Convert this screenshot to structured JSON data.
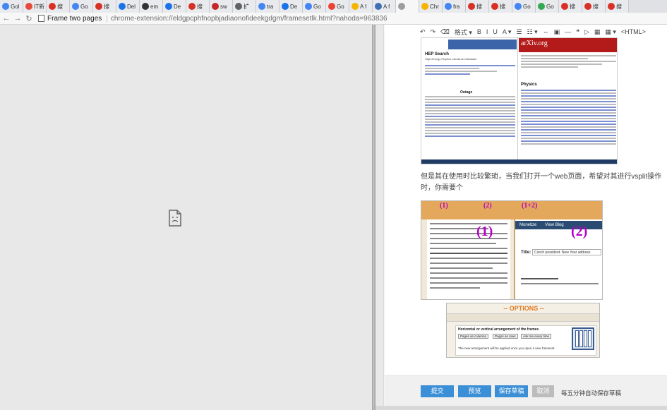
{
  "browser": {
    "tabs": [
      {
        "label": "Gol",
        "color": "#4285f4"
      },
      {
        "label": "IT新",
        "color": "#e64b3b"
      },
      {
        "label": "搜",
        "color": "#d93025"
      },
      {
        "label": "Go",
        "color": "#4285f4"
      },
      {
        "label": "搜",
        "color": "#d93025"
      },
      {
        "label": "Del",
        "color": "#1a73e8"
      },
      {
        "label": "em",
        "color": "#333333"
      },
      {
        "label": "De",
        "color": "#1a73e8"
      },
      {
        "label": "搜",
        "color": "#d93025"
      },
      {
        "label": "sw",
        "color": "#c62828"
      },
      {
        "label": "扩",
        "color": "#5f6368"
      },
      {
        "label": "tra",
        "color": "#4285f4"
      },
      {
        "label": "De",
        "color": "#1a73e8"
      },
      {
        "label": "Go",
        "color": "#4285f4"
      },
      {
        "label": "Go",
        "color": "#ea4335"
      },
      {
        "label": "A f",
        "color": "#f4b400"
      },
      {
        "label": "A f",
        "color": "#3f6fb5"
      },
      {
        "label": "",
        "color": "#9e9e9e",
        "active": true
      },
      {
        "label": "Chr",
        "color": "#f4b400"
      },
      {
        "label": "fra",
        "color": "#4285f4"
      },
      {
        "label": "搜",
        "color": "#d93025"
      },
      {
        "label": "搜",
        "color": "#d93025"
      },
      {
        "label": "Go",
        "color": "#4285f4"
      },
      {
        "label": "Go",
        "color": "#34a853"
      },
      {
        "label": "搜",
        "color": "#d93025"
      },
      {
        "label": "搜",
        "color": "#d93025"
      },
      {
        "label": "搜",
        "color": "#d93025"
      }
    ],
    "nav": {
      "back": "←",
      "forward": "→",
      "reload": "↻"
    },
    "page_title": "Frame two pages",
    "url_sep": "|",
    "url": "chrome-extension://eldgpcphfnopbjadiaonofideekgdgm/framesetlk.html?nahoda=963836"
  },
  "left_frame": {
    "placeholder_icon": "broken-page-icon"
  },
  "editor": {
    "toolbar": [
      "↶",
      "↷",
      "⌫",
      "格式 ▾",
      "B",
      "I",
      "U",
      "A ▾",
      "☰",
      "☷ ▾",
      "⇔",
      "▣",
      "—",
      "❝",
      "▷",
      "▦",
      "▦ ▾",
      "<HTML>"
    ],
    "shot1": {
      "hep_title": "HEP Search",
      "hep_subtitle": "High-Energy Physics Literature Database",
      "hep_outage": "Outage",
      "arxiv_logo": "arXiv.org",
      "arxiv_section": "Physics"
    },
    "paragraph": "但是其在使用时比较繁琐，当我们打开一个web页面，希望对其进行vsplit操作时，你需要个",
    "shot2": {
      "ann1": "(1)",
      "ann2": "(2)",
      "ann3": "(1+2)",
      "ann_big1": "(1)",
      "ann_big2": "(2)",
      "blogger_tab1": "Monetize",
      "blogger_tab2": "View Blog",
      "title_label": "Title:",
      "title_value": "Czech president: New Year address"
    },
    "options": {
      "title": "-- OPTIONS --",
      "heading": "Horizontal or vertical arrangement of the frames",
      "btn1": "Pages as columns",
      "btn2": "Pages as rows",
      "btn3": "Ask me every time",
      "note": "The new arrangement will be applied once you open a new frameset."
    },
    "actions": {
      "submit": "提交",
      "preview": "预览",
      "save_draft": "保存草稿",
      "cancel": "取消",
      "autosave_note": "每五分钟自动保存草稿"
    }
  }
}
